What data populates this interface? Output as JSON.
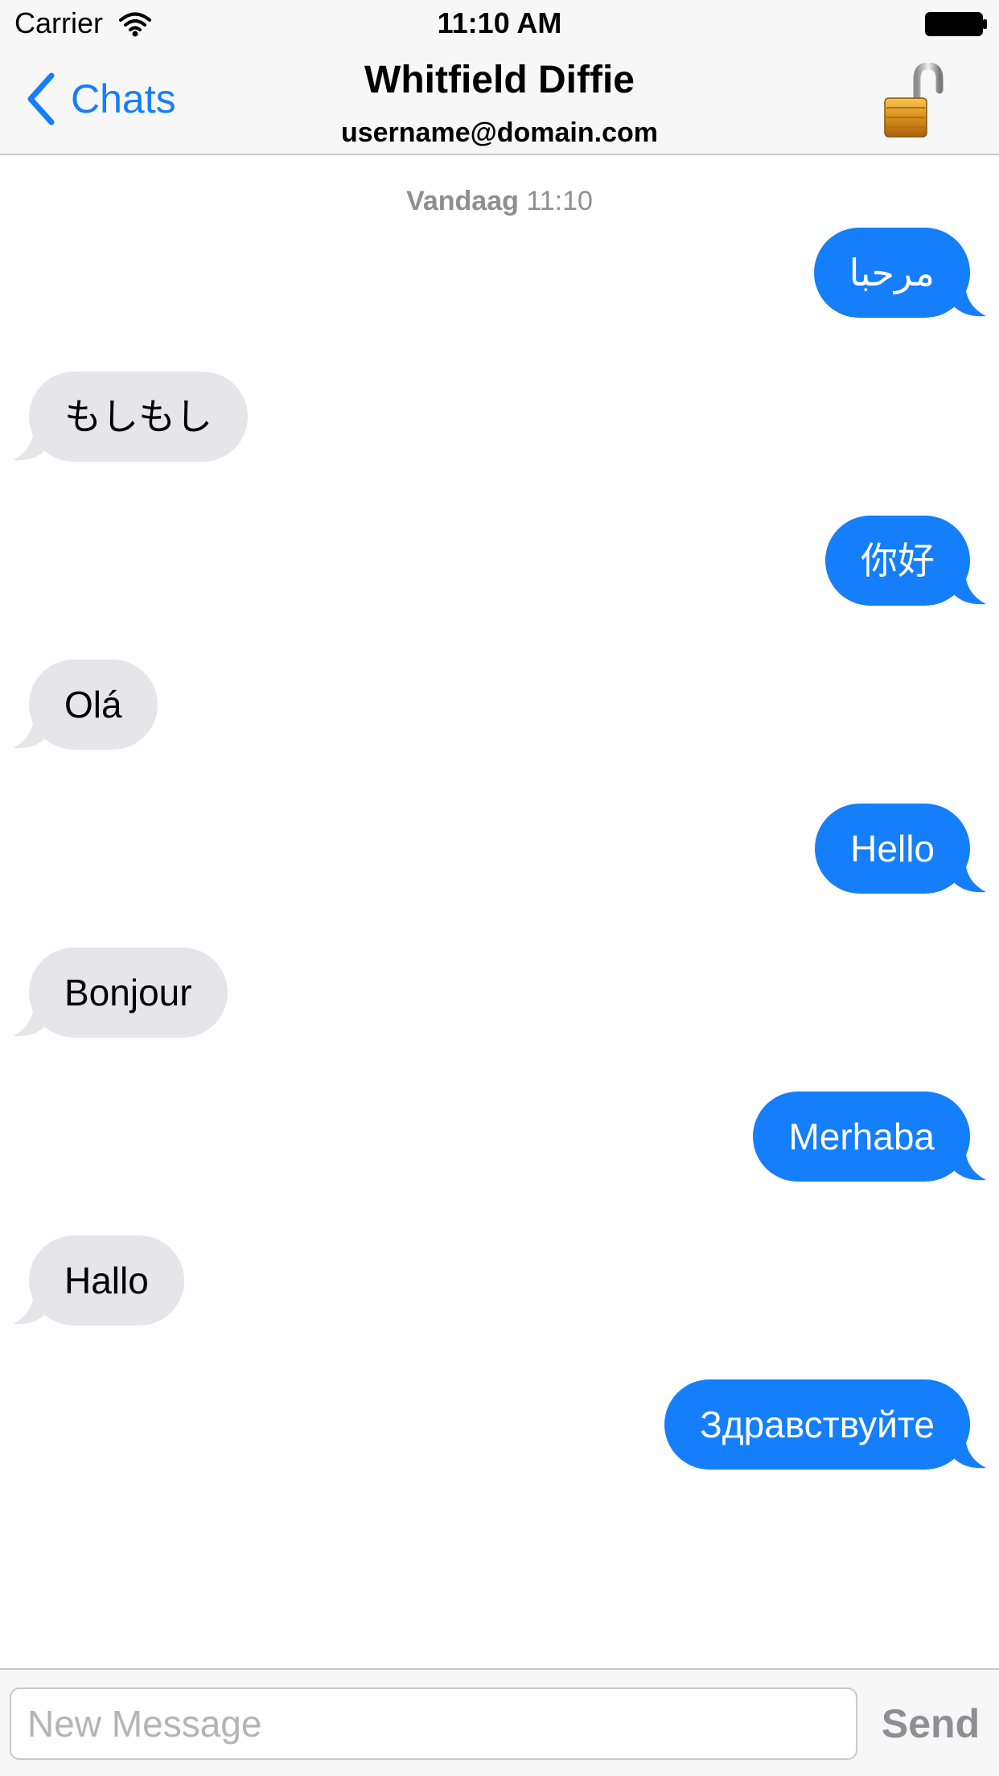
{
  "status_bar": {
    "carrier": "Carrier",
    "time": "11:10 AM",
    "wifi_icon": "wifi-icon",
    "battery_icon": "battery-icon"
  },
  "nav": {
    "back_label": "Chats",
    "back_icon": "chevron-left-icon",
    "title": "Whitfield Diffie",
    "subtitle": "username@domain.com",
    "lock_icon": "unlocked-padlock-icon"
  },
  "conversation": {
    "date_day": "Vandaag",
    "date_time": "11:10",
    "messages": [
      {
        "direction": "outgoing",
        "text": "مرحبا"
      },
      {
        "direction": "incoming",
        "text": "もしもし"
      },
      {
        "direction": "outgoing",
        "text": "你好"
      },
      {
        "direction": "incoming",
        "text": "Olá"
      },
      {
        "direction": "outgoing",
        "text": "Hello"
      },
      {
        "direction": "incoming",
        "text": "Bonjour"
      },
      {
        "direction": "outgoing",
        "text": "Merhaba"
      },
      {
        "direction": "incoming",
        "text": "Hallo"
      },
      {
        "direction": "outgoing",
        "text": "Здравствуйте"
      }
    ]
  },
  "composer": {
    "placeholder": "New Message",
    "value": "",
    "send_label": "Send"
  },
  "colors": {
    "accent": "#157efb",
    "incoming_bubble": "#e5e5ea",
    "bar_background": "#f7f7f7",
    "muted_text": "#8e8e93"
  }
}
